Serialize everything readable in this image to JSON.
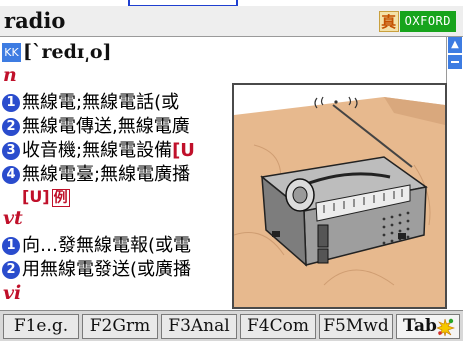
{
  "header": {
    "headword": "radio",
    "brand_glyph": "真",
    "brand_label": "OXFORD"
  },
  "entry": {
    "phonetic_tag": "KK",
    "phonetic": "[ˋredɪ͵o]",
    "noun": {
      "pos": "n",
      "senses": [
        {
          "num": "1",
          "text": "無線電;無線電話(或"
        },
        {
          "num": "2",
          "text": "無線電傳送,無線電廣"
        },
        {
          "num": "3",
          "text": "收音機;無線電設備"
        },
        {
          "num": "4",
          "text": "無線電臺;無線電廣播"
        }
      ],
      "sense3_tag": "[U",
      "tags": "[U]",
      "tag_example": "例"
    },
    "verb_transitive": {
      "pos": "vt",
      "senses": [
        {
          "num": "1",
          "text": "向…發無線電報(或電"
        },
        {
          "num": "2",
          "text": "用無線電發送(或廣播"
        }
      ]
    },
    "verb_intransitive": {
      "pos": "vi"
    }
  },
  "picture": {
    "subject": "radio illustration"
  },
  "toolbar": {
    "f1": "F1e.g.",
    "f2": "F2Grm",
    "f3": "F3Anal",
    "f4": "F4Com",
    "f5": "F5Mwd",
    "tab": "Tab"
  },
  "colors": {
    "accent_blue": "#2a4ccd",
    "pos_red": "#c0102a",
    "brand_green": "#17a41c"
  },
  "icons": {
    "kk_badge": "kk-badge-icon",
    "scroll_up": "scroll-up-icon",
    "tab": "tab-sparkle-icon"
  }
}
